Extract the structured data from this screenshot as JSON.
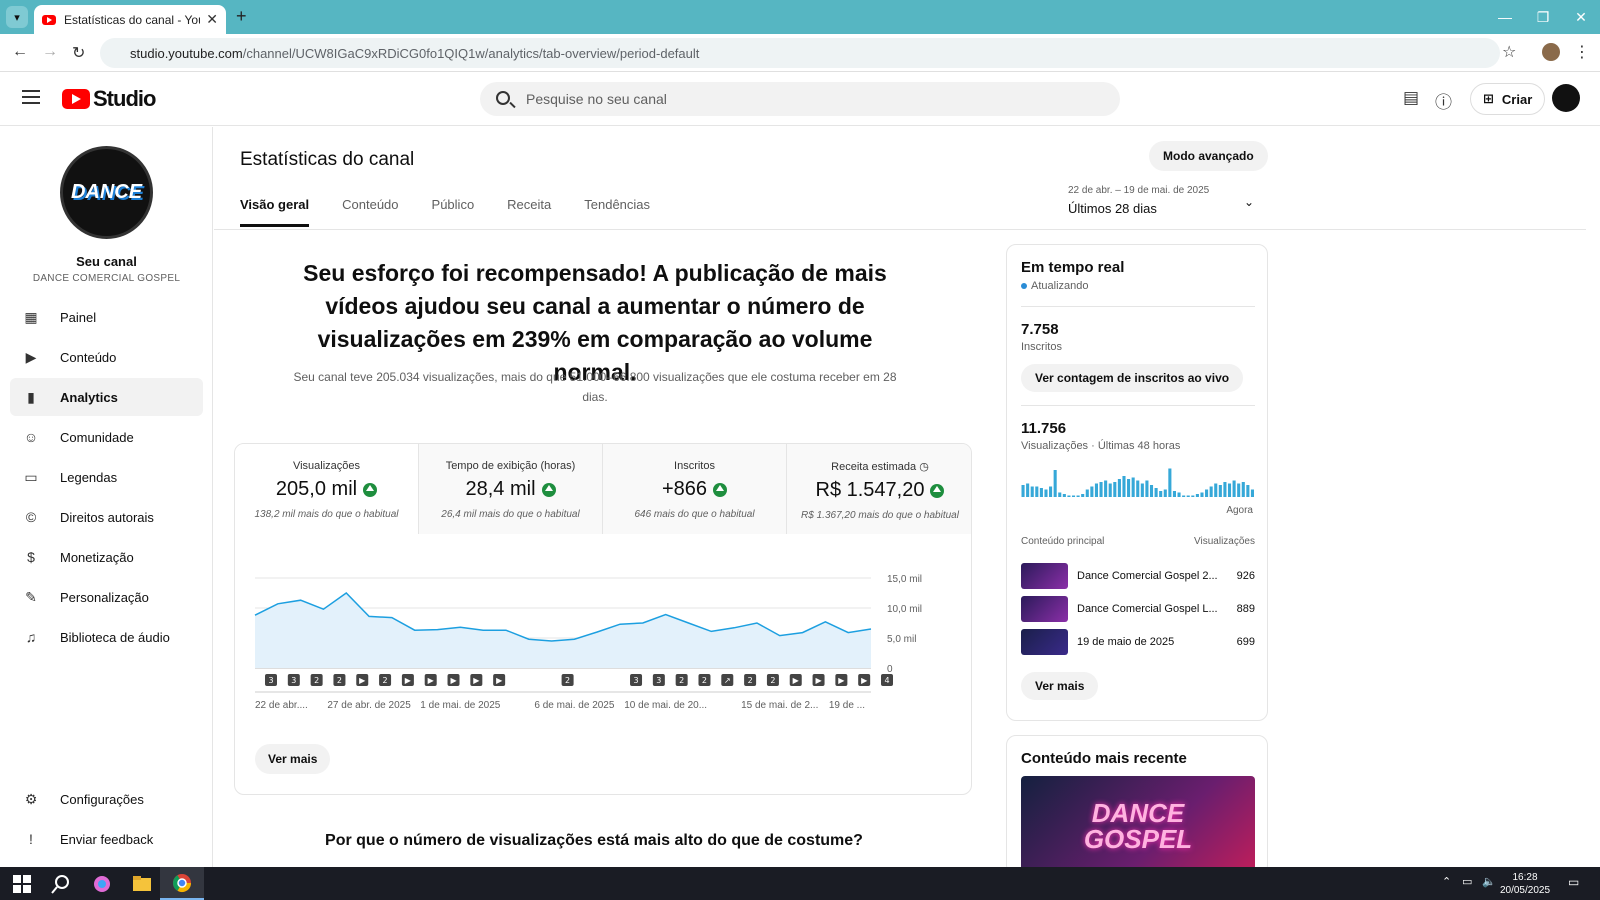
{
  "browser": {
    "tab_title": "Estatísticas do canal - YouTube",
    "url_host": "studio.youtube.com",
    "url_path": "/channel/UCW8IGaC9xRDiCG0fo1QIQ1w/analytics/tab-overview/period-default"
  },
  "header": {
    "logo_text": "Studio",
    "search_placeholder": "Pesquise no seu canal",
    "create_label": "Criar"
  },
  "sidebar": {
    "channel_label": "Seu canal",
    "channel_name": "DANCE COMERCIAL GOSPEL",
    "logo_text": "DANCE",
    "items": [
      {
        "label": "Painel",
        "icon": "dashboard-icon"
      },
      {
        "label": "Conteúdo",
        "icon": "content-icon"
      },
      {
        "label": "Analytics",
        "icon": "analytics-icon"
      },
      {
        "label": "Comunidade",
        "icon": "community-icon"
      },
      {
        "label": "Legendas",
        "icon": "subtitles-icon"
      },
      {
        "label": "Direitos autorais",
        "icon": "copyright-icon"
      },
      {
        "label": "Monetização",
        "icon": "dollar-icon"
      },
      {
        "label": "Personalização",
        "icon": "wand-icon"
      },
      {
        "label": "Biblioteca de áudio",
        "icon": "audio-library-icon"
      }
    ],
    "bottom_items": [
      {
        "label": "Configurações",
        "icon": "gear-icon"
      },
      {
        "label": "Enviar feedback",
        "icon": "feedback-icon"
      }
    ]
  },
  "main": {
    "title": "Estatísticas do canal",
    "advanced_mode": "Modo avançado",
    "tabs": [
      "Visão geral",
      "Conteúdo",
      "Público",
      "Receita",
      "Tendências"
    ],
    "date_range_sub": "22 de abr. – 19 de mai. de 2025",
    "date_range_label": "Últimos 28 dias",
    "headline": "Seu esforço foi recompensado! A publicação de mais vídeos ajudou seu canal a aumentar o número de visualizações em 239% em comparação ao volume normal.",
    "headline_sub": "Seu canal teve 205.034 visualizações, mais do que 51.000–66.800 visualizações que ele costuma receber em 28 dias.",
    "metrics": [
      {
        "label": "Visualizações",
        "value": "205,0 mil",
        "note": "138,2 mil mais do que o habitual"
      },
      {
        "label": "Tempo de exibição (horas)",
        "value": "28,4 mil",
        "note": "26,4 mil mais do que o habitual"
      },
      {
        "label": "Inscritos",
        "value": "+866",
        "note": "646 mais do que o habitual"
      },
      {
        "label": "Receita estimada",
        "value": "R$ 1.547,20",
        "note": "R$ 1.367,20 mais do que o habitual"
      }
    ],
    "see_more": "Ver mais",
    "why_title": "Por que o número de visualizações está mais alto do que de costume?"
  },
  "chart_data": {
    "type": "area",
    "x": [
      "22 de abr.",
      "23 de abr.",
      "24 de abr.",
      "25 de abr.",
      "26 de abr.",
      "27 de abr.",
      "28 de abr.",
      "29 de abr.",
      "30 de abr.",
      "1 de mai.",
      "2 de mai.",
      "3 de mai.",
      "4 de mai.",
      "5 de mai.",
      "6 de mai.",
      "7 de mai.",
      "8 de mai.",
      "9 de mai.",
      "10 de mai.",
      "11 de mai.",
      "12 de mai.",
      "13 de mai.",
      "14 de mai.",
      "15 de mai.",
      "16 de mai.",
      "17 de mai.",
      "18 de mai.",
      "19 de mai."
    ],
    "values": [
      8.8,
      10.7,
      11.3,
      9.8,
      12.5,
      8.6,
      8.4,
      6.3,
      6.4,
      6.8,
      6.3,
      6.3,
      4.8,
      4.5,
      4.8,
      6.0,
      7.3,
      7.5,
      8.9,
      7.5,
      6.1,
      6.7,
      7.5,
      5.4,
      5.9,
      7.7,
      5.9,
      6.5
    ],
    "ylim": [
      0,
      15
    ],
    "yticks": [
      "15,0 mil",
      "10,0 mil",
      "5,0 mil",
      "0"
    ],
    "xtick_labels": [
      "22 de abr....",
      "27 de abr. de 2025",
      "1 de mai. de 2025",
      "6 de mai. de 2025",
      "10 de mai. de 20...",
      "15 de mai. de 2...",
      "19 de ..."
    ],
    "upload_markers": [
      "3",
      "3",
      "2",
      "2",
      "▶",
      "2",
      "▶",
      "▶",
      "▶",
      "▶",
      "▶",
      "",
      "",
      "2",
      "",
      "",
      "3",
      "3",
      "2",
      "2",
      "↗",
      "2",
      "2",
      "▶",
      "▶",
      "▶",
      "▶",
      "4"
    ],
    "grid": true,
    "fill_color": "#e3f1fb",
    "line_color": "#1c9fe0"
  },
  "realtime": {
    "title": "Em tempo real",
    "status": "Atualizando",
    "subs_value": "7.758",
    "subs_label": "Inscritos",
    "subs_button": "Ver contagem de inscritos ao vivo",
    "views_value": "11.756",
    "views_label": "Visualizações · Últimas 48 horas",
    "now_label": "Agora",
    "bars": [
      0.4,
      0.45,
      0.35,
      0.35,
      0.3,
      0.25,
      0.35,
      0.9,
      0.15,
      0.1,
      0.05,
      0.05,
      0.05,
      0.1,
      0.25,
      0.35,
      0.45,
      0.5,
      0.55,
      0.45,
      0.5,
      0.6,
      0.7,
      0.6,
      0.65,
      0.55,
      0.45,
      0.55,
      0.4,
      0.3,
      0.2,
      0.25,
      0.95,
      0.2,
      0.15,
      0.05,
      0.05,
      0.05,
      0.1,
      0.15,
      0.25,
      0.35,
      0.45,
      0.4,
      0.5,
      0.45,
      0.55,
      0.45,
      0.5,
      0.4,
      0.25
    ],
    "top_header": "Conteúdo principal",
    "top_header_right": "Visualizações",
    "top_items": [
      {
        "name": "Dance Comercial Gospel 2...",
        "views": "926"
      },
      {
        "name": "Dance Comercial Gospel L...",
        "views": "889"
      },
      {
        "name": "19 de maio de 2025",
        "views": "699"
      }
    ],
    "see_more": "Ver mais"
  },
  "recent": {
    "title": "Conteúdo mais recente",
    "thumb_text_1": "DANCE",
    "thumb_text_2": "GOSPEL"
  },
  "taskbar": {
    "time": "16:28",
    "date": "20/05/2025"
  }
}
